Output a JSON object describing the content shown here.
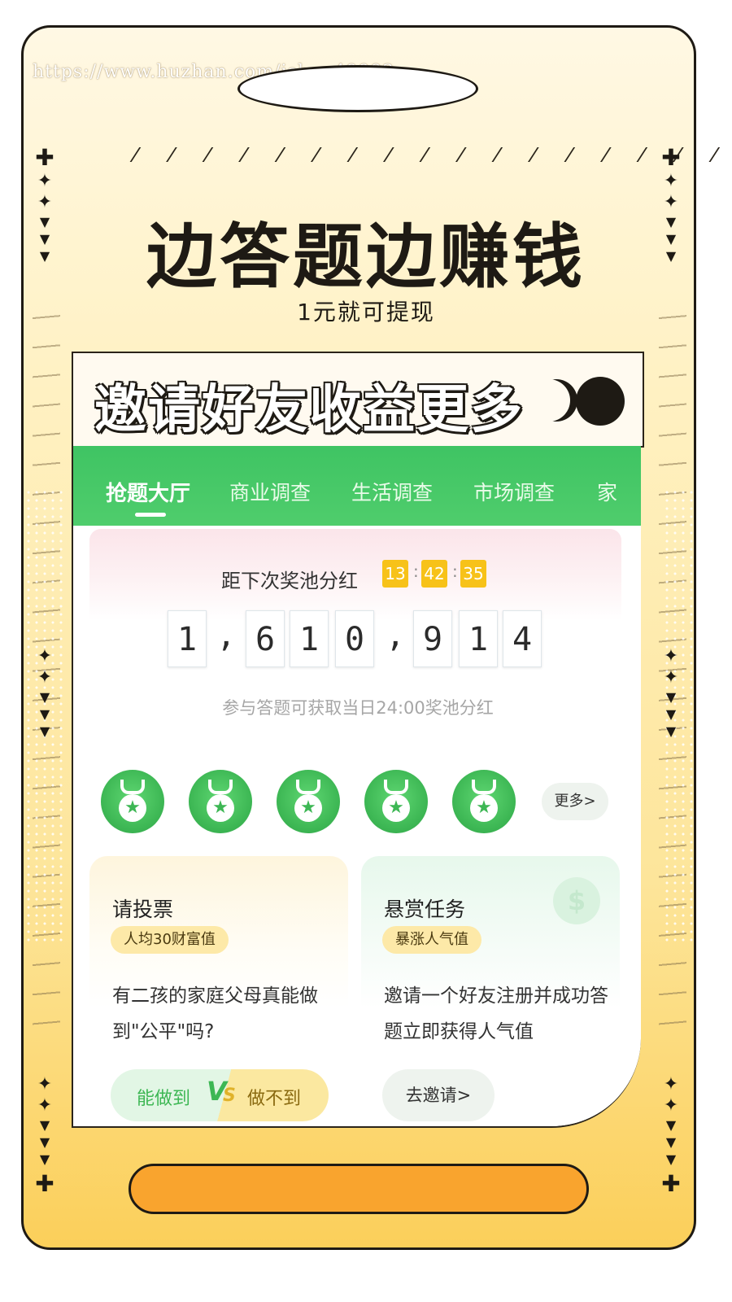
{
  "watermark": "https://www.huzhan.com/ishop49992",
  "decor": {
    "slashes": "/ / / / / / / / / / / / / / / / / / / / / / / / / /"
  },
  "headline": "边答题边赚钱",
  "subline": "1元就可提现",
  "invite_banner": "邀请好友收益更多",
  "tabs": [
    "抢题大厅",
    "商业调查",
    "生活调查",
    "市场调查",
    "家"
  ],
  "pool": {
    "label": "距下次奖池分红",
    "countdown": [
      "13",
      "42",
      "35"
    ],
    "countdown_sep": ":",
    "digits": [
      "1",
      "6",
      "1",
      "0",
      "9",
      "1",
      "4"
    ],
    "comma": ",",
    "note": "参与答题可获取当日24:00奖池分红"
  },
  "medal_icon": "medal-star-icon",
  "more_label": "更多>",
  "vote_card": {
    "title": "请投票",
    "badge": "人均30财富值",
    "question": "有二孩的家庭父母真能做到\"公平\"吗?",
    "yes": "能做到",
    "no": "做不到",
    "vs_v": "V",
    "vs_s": "S"
  },
  "task_card": {
    "title": "悬赏任务",
    "badge": "暴涨人气值",
    "desc": "邀请一个好友注册并成功答题立即获得人气值",
    "button": "去邀请>",
    "icon_glyph": "$"
  },
  "colors": {
    "accent_green": "#3fc463",
    "countdown_yellow": "#f7c219",
    "bottom_orange": "#f9a42e"
  }
}
